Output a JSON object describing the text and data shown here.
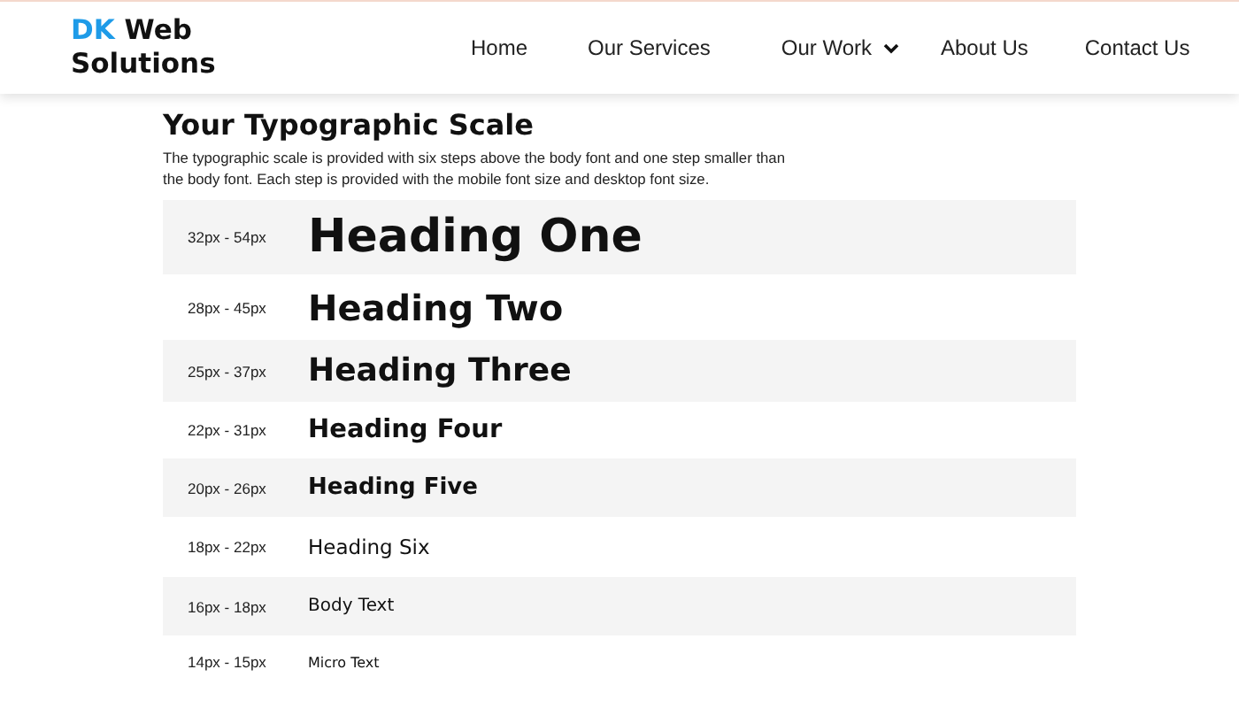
{
  "header": {
    "logo": {
      "accent": "DK",
      "rest": "Web Solutions"
    },
    "nav": [
      {
        "label": "Home",
        "dropdown": false
      },
      {
        "label": "Our Services",
        "dropdown": false
      },
      {
        "label": "Our Work",
        "dropdown": true
      },
      {
        "label": "About Us",
        "dropdown": false
      },
      {
        "label": "Contact Us",
        "dropdown": false
      }
    ]
  },
  "section": {
    "title": "Your Typographic Scale",
    "description": "The typographic scale is provided with six steps above the body font and one step smaller than the body font. Each step is provided with the mobile font size and desktop font size.",
    "rows": [
      {
        "kind": "h1",
        "size": "32px - 54px",
        "sample": "Heading One"
      },
      {
        "kind": "h2",
        "size": "28px - 45px",
        "sample": "Heading Two"
      },
      {
        "kind": "h3",
        "size": "25px - 37px",
        "sample": "Heading Three"
      },
      {
        "kind": "h4",
        "size": "22px - 31px",
        "sample": "Heading Four"
      },
      {
        "kind": "h5",
        "size": "20px - 26px",
        "sample": "Heading Five"
      },
      {
        "kind": "h6",
        "size": "18px - 22px",
        "sample": "Heading Six"
      },
      {
        "kind": "body",
        "size": "16px - 18px",
        "sample": "Body Text"
      },
      {
        "kind": "micro",
        "size": "14px - 15px",
        "sample": "Micro Text"
      }
    ]
  }
}
